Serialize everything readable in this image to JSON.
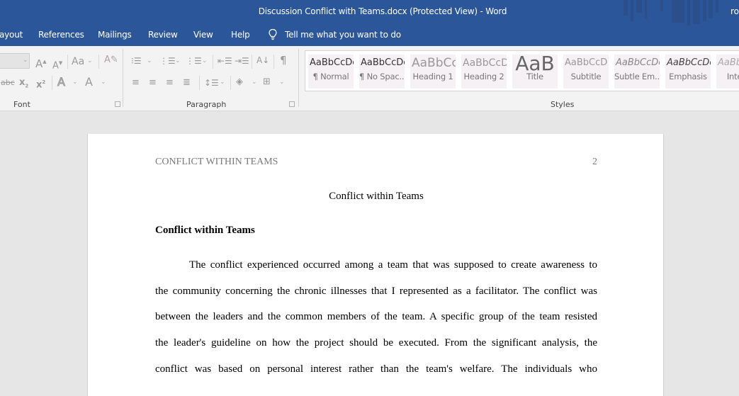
{
  "window": {
    "title": "Discussion Conflict with Teams.docx (Protected View)  -  Word",
    "user_initial": "ro"
  },
  "ribbon_tabs": [
    {
      "label": "ayout"
    },
    {
      "label": "References"
    },
    {
      "label": "Mailings"
    },
    {
      "label": "Review"
    },
    {
      "label": "View"
    },
    {
      "label": "Help"
    }
  ],
  "tell_me": {
    "icon": "lightbulb-icon",
    "placeholder": "Tell me what you want to do"
  },
  "ribbon_groups": {
    "font": {
      "label": "Font",
      "font_size_value": "",
      "icons": [
        "grow-font-icon",
        "shrink-font-icon",
        "change-case-icon",
        "clear-formatting-icon",
        "strikethrough-icon",
        "subscript-icon",
        "superscript-icon",
        "text-effects-icon",
        "font-color-icon"
      ]
    },
    "paragraph": {
      "label": "Paragraph",
      "icons": [
        "bullets-icon",
        "numbering-icon",
        "multilevel-list-icon",
        "decrease-indent-icon",
        "increase-indent-icon",
        "sort-icon",
        "show-formatting-marks-icon",
        "align-left-icon",
        "center-icon",
        "align-right-icon",
        "justify-icon",
        "line-spacing-icon",
        "shading-icon",
        "borders-icon"
      ]
    },
    "styles": {
      "label": "Styles",
      "items": [
        {
          "sample": "AaBbCcDc",
          "name": "¶ Normal"
        },
        {
          "sample": "AaBbCcDc",
          "name": "¶ No Spac..."
        },
        {
          "sample": "AaBbCc",
          "name": "Heading 1"
        },
        {
          "sample": "AaBbCcD",
          "name": "Heading 2"
        },
        {
          "sample": "AaB",
          "name": "Title"
        },
        {
          "sample": "AaBbCcD",
          "name": "Subtitle"
        },
        {
          "sample": "AaBbCcDc",
          "name": "Subtle Em..."
        },
        {
          "sample": "AaBbCcDc",
          "name": "Emphasis"
        },
        {
          "sample": "AaBbCcDc",
          "name": "Intens"
        }
      ]
    }
  },
  "document": {
    "running_head": "CONFLICT WITHIN TEAMS",
    "page_number": "2",
    "title": "Conflict within Teams",
    "heading": "Conflict within Teams",
    "body_lines": [
      "The conflict experienced occurred among a team that was supposed to create awareness to",
      "the community concerning the chronic illnesses that I represented as a facilitator. The conflict was",
      "between the leaders and the common members of the team. A specific group of the team resisted",
      "the leader's guideline on how the project should be executed. From the significant analysis, the",
      "conflict was based on personal interest rather than the team's welfare. The individuals who"
    ]
  },
  "colors": {
    "titlebar": "#2b579a",
    "ribbon_bg": "#f3f3f3",
    "workspace_bg": "#e6e6e6",
    "page_bg": "#ffffff",
    "header_text": "#7a7a7a"
  }
}
